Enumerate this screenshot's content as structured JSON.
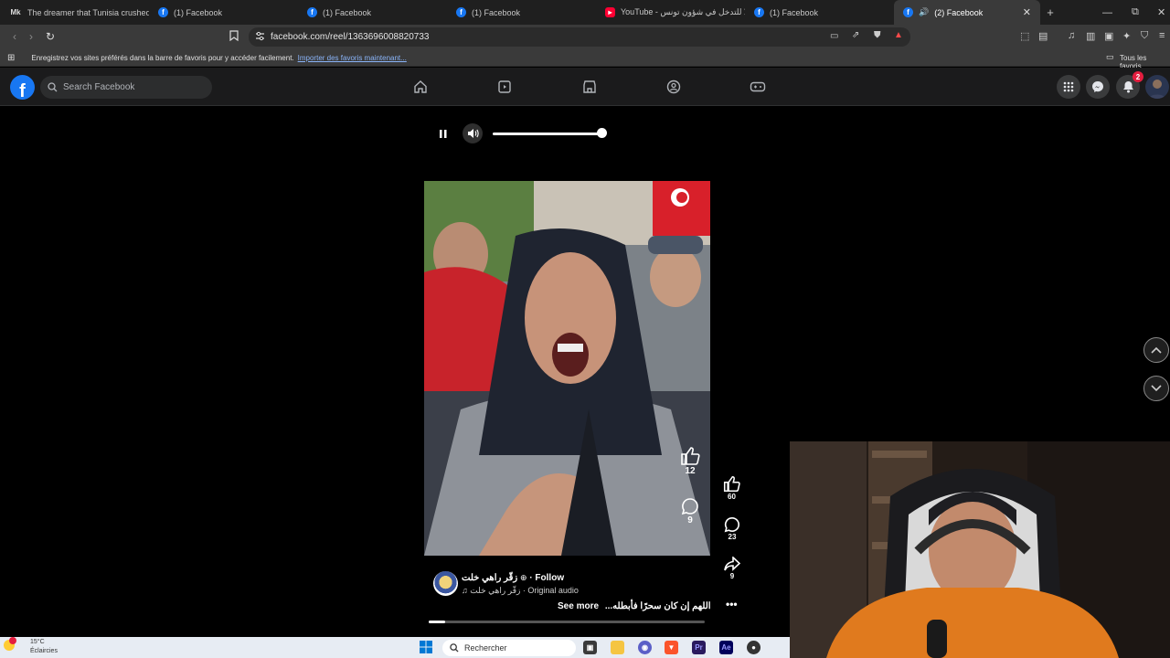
{
  "browser": {
    "tabs": [
      {
        "title": "The dreamer that Tunisia crushed. T",
        "icon": "mk-icon",
        "active": false
      },
      {
        "title": "(1) Facebook",
        "icon": "facebook-icon",
        "active": false
      },
      {
        "title": "(1) Facebook",
        "icon": "facebook-icon",
        "active": false
      },
      {
        "title": "(1) Facebook",
        "icon": "facebook-icon",
        "active": false
      },
      {
        "title": "YouTube - لا للتدخل في شؤون تونس",
        "icon": "youtube-icon",
        "active": false
      },
      {
        "title": "(1) Facebook",
        "icon": "facebook-icon",
        "active": false
      },
      {
        "title": "(2) Facebook",
        "icon": "facebook-icon",
        "active": true
      }
    ],
    "url": "facebook.com/reel/1363696008820733",
    "bookmarks_prompt": "Enregistrez vos sites préférés dans la barre de favoris pour y accéder facilement.",
    "bookmarks_link": "Importer des favoris maintenant...",
    "all_bookmarks": "Tous les favoris"
  },
  "facebook": {
    "search_placeholder": "Search Facebook",
    "notifications_count": "2"
  },
  "reel": {
    "volume_level": 1.0,
    "video_likes": "12",
    "video_comments": "9",
    "likes": "60",
    "comments": "23",
    "shares": "9",
    "author": "زقّر راهي خلت",
    "follow_label": "· Follow",
    "audio": "زقّر راهي خلت · Original audio",
    "caption": "اللهم إن كان سحرًا فأبطله...",
    "see_more": "See more",
    "progress": 0.06
  },
  "taskbar": {
    "temperature": "15°C",
    "weather": "Éclaircies",
    "search_placeholder": "Rechercher"
  },
  "colors": {
    "facebook_blue": "#1877f2",
    "badge_red": "#e41e3f"
  }
}
